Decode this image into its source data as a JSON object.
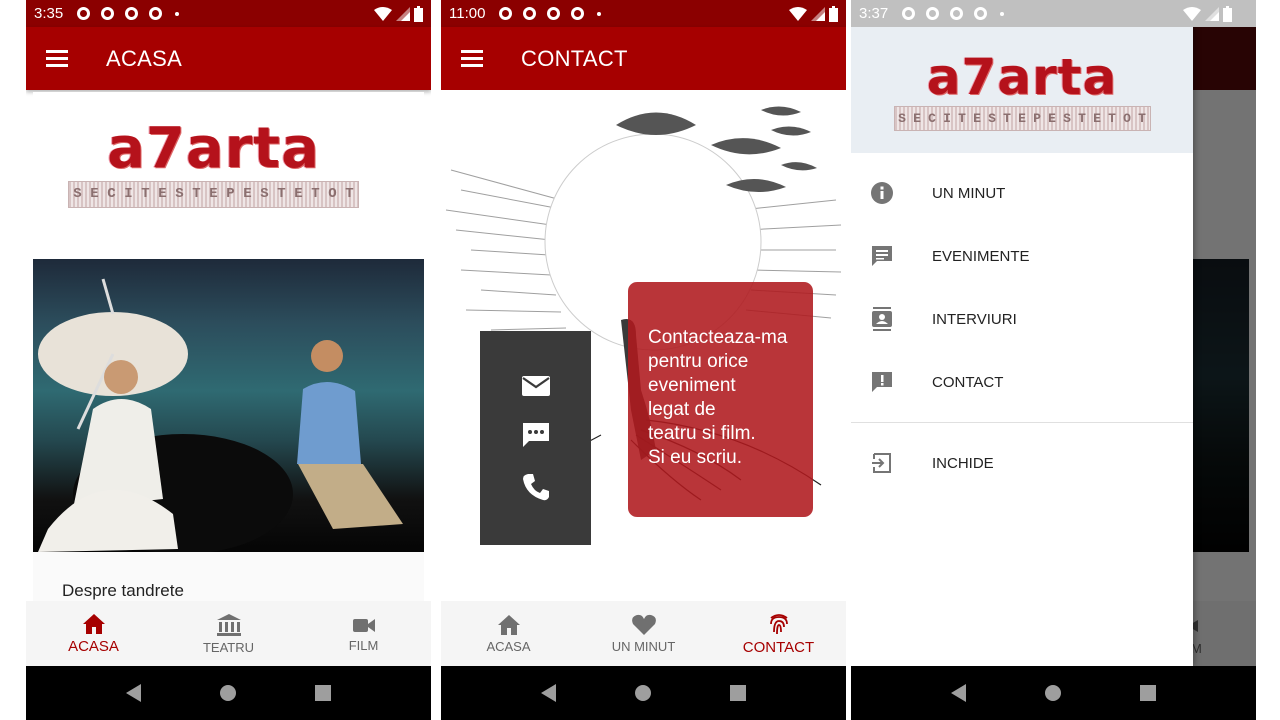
{
  "screens": [
    {
      "status_time": "3:35",
      "title": "ACASA",
      "logo": {
        "main": "a7arta",
        "tagline": [
          "S",
          "E",
          "C",
          "I",
          "T",
          "E",
          "S",
          "T",
          "E",
          "P",
          "E",
          "S",
          "T",
          "E",
          "T",
          "O",
          "T"
        ]
      },
      "card_title": "Despre tandrete",
      "bottom_nav": [
        {
          "label": "ACASA",
          "icon": "home-icon",
          "active": true
        },
        {
          "label": "TEATRU",
          "icon": "museum-icon",
          "active": false
        },
        {
          "label": "FILM",
          "icon": "videocam-icon",
          "active": false
        }
      ]
    },
    {
      "status_time": "11:00",
      "title": "CONTACT",
      "contact_icons": [
        "mail-icon",
        "message-icon",
        "phone-icon"
      ],
      "contact_text": [
        "Contacteaza-ma",
        "pentru orice",
        "eveniment",
        "legat de",
        "teatru si film.",
        "Si eu scriu."
      ],
      "bottom_nav": [
        {
          "label": "ACASA",
          "icon": "home-icon",
          "active": false
        },
        {
          "label": "UN MINUT",
          "icon": "heart-icon",
          "active": false
        },
        {
          "label": "CONTACT",
          "icon": "fingerprint-icon",
          "active": true
        }
      ]
    },
    {
      "status_time": "3:37",
      "logo": {
        "main": "a7arta",
        "tagline": [
          "S",
          "E",
          "C",
          "I",
          "T",
          "E",
          "S",
          "T",
          "E",
          "P",
          "E",
          "S",
          "T",
          "E",
          "T",
          "O",
          "T"
        ]
      },
      "drawer_items": [
        {
          "label": "UN MINUT",
          "icon": "info-icon"
        },
        {
          "label": "EVENIMENTE",
          "icon": "comment-icon"
        },
        {
          "label": "INTERVIURI",
          "icon": "contacts-icon"
        },
        {
          "label": "CONTACT",
          "icon": "feedback-icon"
        },
        {
          "label": "INCHIDE",
          "icon": "exit-icon"
        }
      ],
      "partial_nav_label": "M"
    }
  ],
  "colors": {
    "appbar": "#a60000",
    "status": "#8b0000",
    "accent": "#a60000",
    "contact_card": "#af191e"
  }
}
